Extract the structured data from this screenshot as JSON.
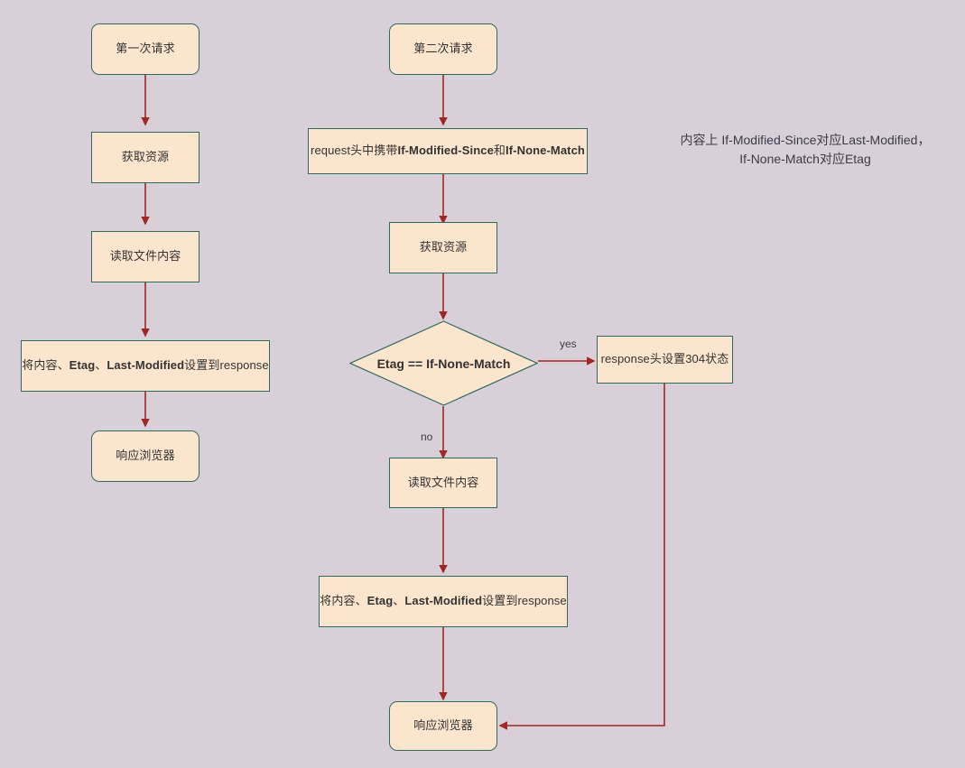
{
  "diagram": {
    "type": "flowchart",
    "background_color": "#d9cfd9",
    "node_fill": "#fbe5cd",
    "node_border": "#2e6b5e",
    "edge_color": "#a02723",
    "text_color": "#333333"
  },
  "nodes": {
    "first_request": "第一次请求",
    "fetch_resource_1": "获取资源",
    "read_file_1": "读取文件内容",
    "set_response_1_parts": [
      {
        "text": "将内容、",
        "bold": false
      },
      {
        "text": "Etag",
        "bold": true
      },
      {
        "text": "、",
        "bold": false
      },
      {
        "text": "Last-Modified",
        "bold": true
      },
      {
        "text": "设置到response",
        "bold": false
      }
    ],
    "respond_browser_1": "响应浏览器",
    "second_request": "第二次请求",
    "request_headers_parts": [
      {
        "text": "request头中携带",
        "bold": false
      },
      {
        "text": "If-Modified-Since",
        "bold": true
      },
      {
        "text": "和",
        "bold": false
      },
      {
        "text": "If-None-Match",
        "bold": true
      }
    ],
    "fetch_resource_2": "获取资源",
    "decision_etag": "Etag == If-None-Match",
    "response_304": "response头设置304状态",
    "read_file_2": "读取文件内容",
    "set_response_2_parts": [
      {
        "text": "将内容、",
        "bold": false
      },
      {
        "text": "Etag",
        "bold": true
      },
      {
        "text": "、",
        "bold": false
      },
      {
        "text": "Last-Modified",
        "bold": true
      },
      {
        "text": "设置到response",
        "bold": false
      }
    ],
    "respond_browser_2": "响应浏览器"
  },
  "edge_labels": {
    "yes": "yes",
    "no": "no"
  },
  "note": {
    "line1": "内容上 If-Modified-Since对应Last-Modified，",
    "line2": "If-None-Match对应Etag"
  }
}
